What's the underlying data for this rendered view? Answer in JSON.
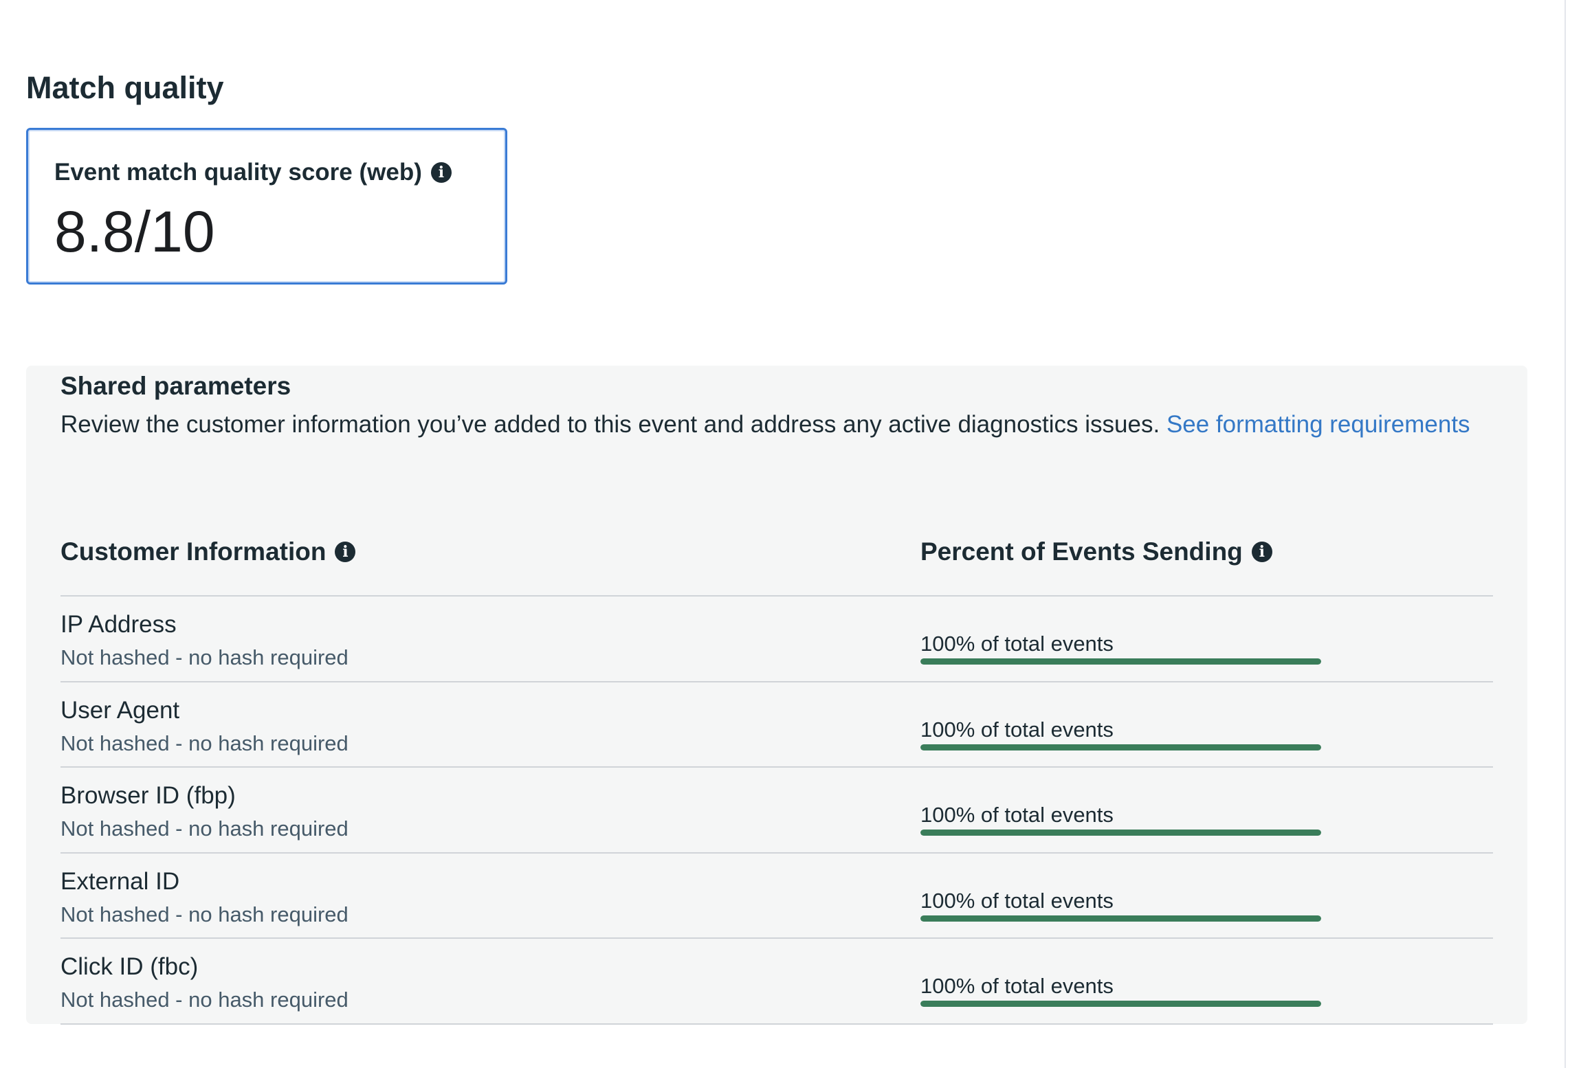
{
  "page": {
    "section_title": "Match quality"
  },
  "score_card": {
    "label": "Event match quality score (web)",
    "value": "8.8/10",
    "info_icon_glyph": "i"
  },
  "shared_parameters": {
    "title": "Shared parameters",
    "description": "Review the customer information you’ve added to this event and address any active diagnostics issues.",
    "link_text": "See formatting requirements",
    "columns": {
      "customer_information": "Customer Information",
      "percent_sending": "Percent of Events Sending"
    },
    "rows": [
      {
        "name": "IP Address",
        "hash_status": "Not hashed - no hash required",
        "percent_label": "100% of total events",
        "percent": 100
      },
      {
        "name": "User Agent",
        "hash_status": "Not hashed - no hash required",
        "percent_label": "100% of total events",
        "percent": 100
      },
      {
        "name": "Browser ID (fbp)",
        "hash_status": "Not hashed - no hash required",
        "percent_label": "100% of total events",
        "percent": 100
      },
      {
        "name": "External ID",
        "hash_status": "Not hashed - no hash required",
        "percent_label": "100% of total events",
        "percent": 100
      },
      {
        "name": "Click ID (fbc)",
        "hash_status": "Not hashed - no hash required",
        "percent_label": "100% of total events",
        "percent": 100
      }
    ]
  },
  "colors": {
    "text_primary": "#1c2b33",
    "text_secondary": "#465a69",
    "link": "#3478c6",
    "card_border": "#3a7bd5",
    "panel_background": "#f5f6f6",
    "progress_fill": "#3a7d5a"
  },
  "icons": {
    "info": "info-icon"
  }
}
